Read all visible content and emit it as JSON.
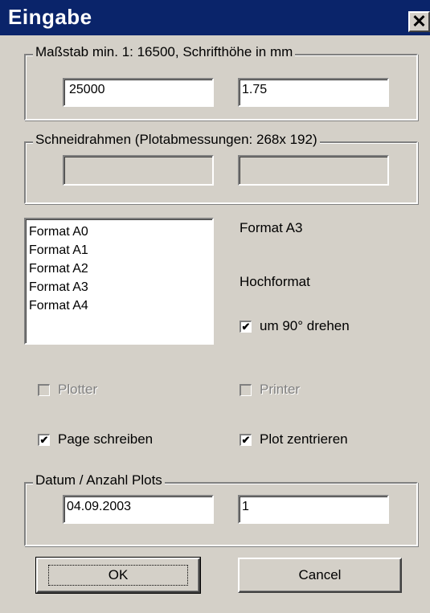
{
  "window": {
    "title": "Eingabe",
    "close_glyph": "✕"
  },
  "massstab": {
    "legend": "Maßstab min. 1:  16500, Schrifthöhe in mm",
    "scale_value": "25000",
    "font_height_value": "1.75"
  },
  "schneidrahmen": {
    "legend": "Schneidrahmen (Plotabmessungen: 268x 192)",
    "field1_value": "",
    "field2_value": ""
  },
  "format_list": {
    "items": [
      "Format A0",
      "Format A1",
      "Format A2",
      "Format A3",
      "Format A4"
    ]
  },
  "format_info": {
    "selected_format": "Format A3",
    "orientation": "Hochformat",
    "rotate_label": "um 90° drehen",
    "rotate_checked": true
  },
  "options": {
    "plotter_label": "Plotter",
    "plotter_checked": false,
    "printer_label": "Printer",
    "printer_checked": false,
    "page_schreiben_label": "Page schreiben",
    "page_schreiben_checked": true,
    "plot_zentrieren_label": "Plot zentrieren",
    "plot_zentrieren_checked": true
  },
  "datum": {
    "legend": "Datum / Anzahl Plots",
    "date_value": "04.09.2003",
    "count_value": "1"
  },
  "buttons": {
    "ok_label": "OK",
    "cancel_label": "Cancel"
  },
  "colors": {
    "titlebar": "#0a246a",
    "dialog_bg": "#d4d0c8"
  }
}
